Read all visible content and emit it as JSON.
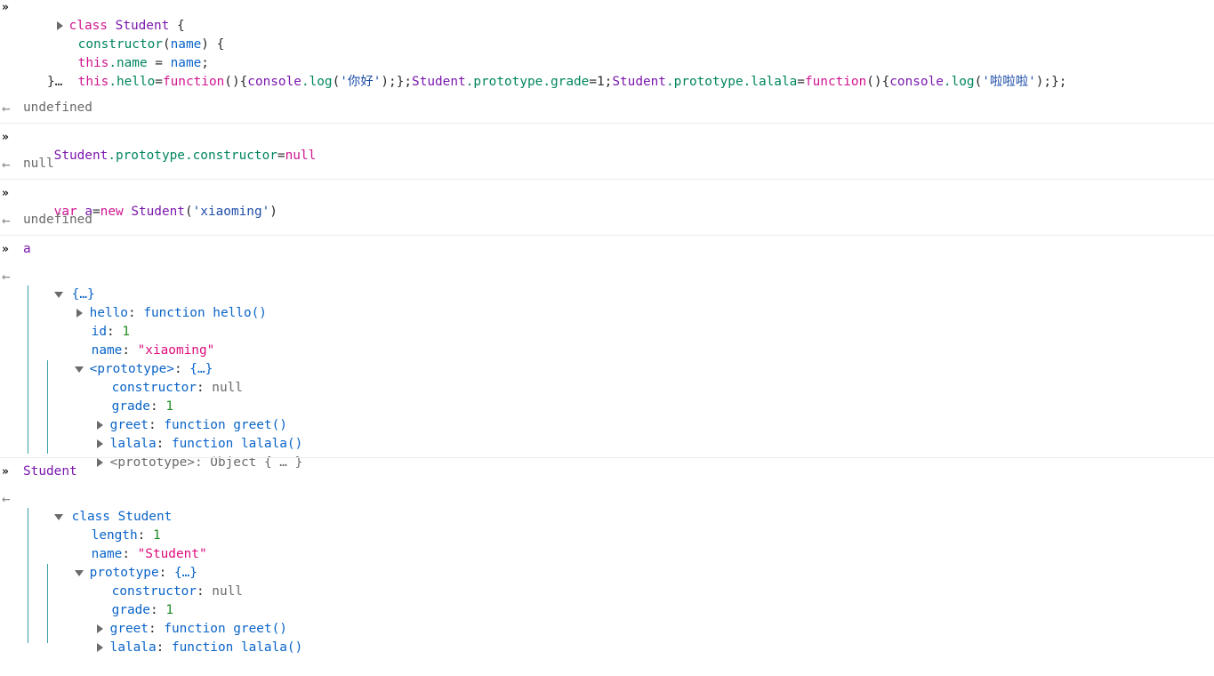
{
  "entries": {
    "e1": {
      "l1_kw": "class",
      "l1_name": "Student",
      "l1_brace": " {",
      "l2_fn": "constructor",
      "l2_open": "(",
      "l2_param": "name",
      "l2_close": ") {",
      "l3_this": "this",
      "l3_prop": ".name",
      "l3_eq": " = ",
      "l3_val": "name",
      "l3_end": ";",
      "l4_this": "this",
      "l4_prop": ".hello",
      "l4_eq": "=",
      "l4_function": "function",
      "l4_paren": "(){",
      "l4_console": "console",
      "l4_log": ".log",
      "l4_lp": "(",
      "l4_str": "'你好'",
      "l4_rest": ");};",
      "l4_student": "Student",
      "l4_proto": ".prototype",
      "l4_grade": ".grade",
      "l4_eq2": "=",
      "l4_num": "1",
      "l4_semi": ";",
      "l4_student2": "Student",
      "l4_proto2": ".prototype",
      "l4_lalala": ".lalala",
      "l4_eq3": "=",
      "l4_function2": "function",
      "l4_paren2": "(){",
      "l4_console2": "console",
      "l4_log2": ".log",
      "l4_lp2": "(",
      "l4_str2": "'啦啦啦'",
      "l4_rest2": ");};",
      "l5": "}…",
      "result": "undefined"
    },
    "e2": {
      "student": "Student",
      "proto": ".prototype",
      "ctor": ".constructor",
      "eq": "=",
      "null_kw": "null",
      "result": "null"
    },
    "e3": {
      "var_kw": "var",
      "varname": " a",
      "eq": "=",
      "new_kw": "new",
      "cls": " Student",
      "lp": "(",
      "arg": "'xiaoming'",
      "rp": ")",
      "result": "undefined"
    },
    "e4": {
      "input": "a",
      "root": "{…}",
      "hello_key": "hello",
      "hello_val": "function hello()",
      "id_key": "id",
      "id_val": "1",
      "name_key": "name",
      "name_val": "\"xiaoming\"",
      "proto_key": "<prototype>",
      "proto_val": "{…}",
      "ctor_key": "constructor",
      "ctor_val": "null",
      "grade_key": "grade",
      "grade_val": "1",
      "greet_key": "greet",
      "greet_val": "function greet()",
      "lalala_key": "lalala",
      "lalala_val": "function lalala()",
      "proto2_key": "<prototype>",
      "proto2_val": "Object { … }"
    },
    "e5": {
      "input": "Student",
      "root": "class Student",
      "length_key": "length",
      "length_val": "1",
      "name_key": "name",
      "name_val": "\"Student\"",
      "proto_key": "prototype",
      "proto_val": "{…}",
      "ctor_key": "constructor",
      "ctor_val": "null",
      "grade_key": "grade",
      "grade_val": "1",
      "greet_key": "greet",
      "greet_val": "function greet()",
      "lalala_key": "lalala",
      "lalala_val": "function lalala()"
    }
  },
  "colors": {
    "keyword": "#d0158f",
    "function_blue": "#0a64c8",
    "identifier_purple": "#7a18ac",
    "string_pink": "#dd0c7b",
    "number_green": "#1f8a1f",
    "tree_line": "#3aa0a8"
  },
  "icons": {
    "input_prompt": "double-chevron-right-icon",
    "output_marker": "arrow-left-icon",
    "expand": "triangle-right-icon",
    "collapse": "triangle-down-icon"
  },
  "glyphs": {
    "input_prompt": "»",
    "output_arrow": "←",
    "colon": ": "
  }
}
